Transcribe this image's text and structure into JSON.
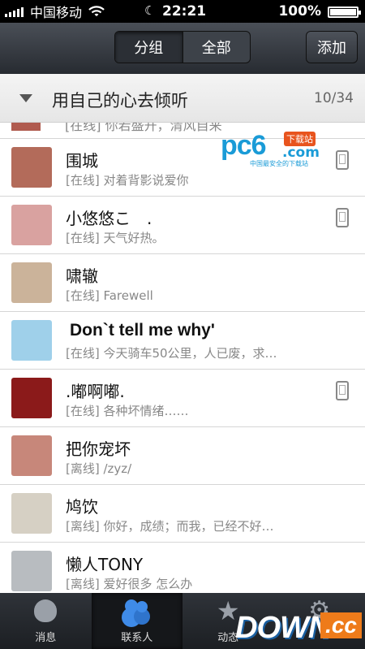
{
  "status_bar": {
    "carrier": "中国移动",
    "time": "22:21",
    "battery_percent": "100%",
    "battery_level": 1.0
  },
  "nav": {
    "segments": [
      "分组",
      "全部"
    ],
    "active_segment": 0,
    "add_label": "添加"
  },
  "group": {
    "title": "用自己的心去倾听",
    "count": "10/34"
  },
  "partial_row": {
    "status": "[在线] 你若盛开，清风自来"
  },
  "contacts": [
    {
      "name": "围城",
      "status": "[在线] 对着背影说爱你",
      "phone": true,
      "avatar_color": "#b36b5a"
    },
    {
      "name": "小悠悠こ　.",
      "status": "[在线] 天气好热。",
      "phone": true,
      "avatar_color": "#d9a2a0"
    },
    {
      "name": "啸辙",
      "status": "[在线] Farewell",
      "phone": false,
      "avatar_color": "#cbb39a"
    },
    {
      "name": "Don`t tell me why'",
      "status": "[在线] 今天骑车50公里，人已废，求…",
      "phone": false,
      "avatar_color": "#9fd0ea",
      "bold": true
    },
    {
      "name": ".嘟啊嘟.",
      "status": "[在线] 各种坏情绪……",
      "phone": true,
      "avatar_color": "#8b1a1a"
    },
    {
      "name": "把你宠坏",
      "status": "[离线]  /zyz/",
      "phone": false,
      "avatar_color": "#c7877a"
    },
    {
      "name": "鸠饮",
      "status": "[离线] 你好，成绩；而我，已经不好…",
      "phone": false,
      "avatar_color": "#d6d0c4"
    },
    {
      "name": "懒人TONY",
      "status": "[离线] 爱好很多 怎么办",
      "phone": false,
      "avatar_color": "#b8bcc0"
    }
  ],
  "tabs": [
    {
      "label": "消息",
      "icon": "chat-bubble-icon"
    },
    {
      "label": "联系人",
      "icon": "contacts-icon"
    },
    {
      "label": "动态",
      "icon": "star-icon"
    },
    {
      "label": "",
      "icon": "gear-icon"
    }
  ],
  "active_tab": 1,
  "watermarks": {
    "pc6_logo": "pc6",
    "pc6_tag": "下载站",
    "pc6_domain": ".com",
    "pc6_sub": "中国最安全的下载站",
    "down_logo": "DOWN",
    "down_suffix": ".cc"
  }
}
